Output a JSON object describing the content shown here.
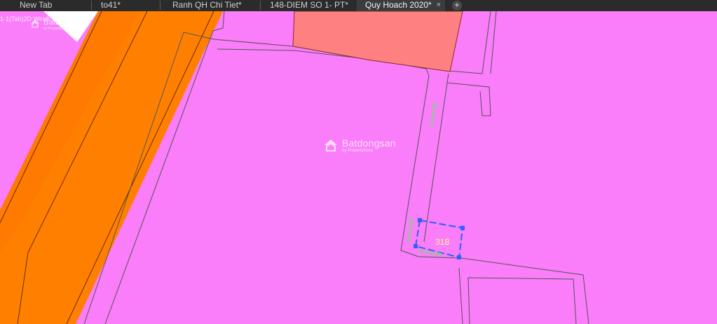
{
  "tabs": [
    {
      "label": "New Tab",
      "active": false
    },
    {
      "label": "to41*",
      "active": false
    },
    {
      "label": "Ranh QH Chi Tiet*",
      "active": false
    },
    {
      "label": "148-DIEM SO 1- PT*",
      "active": false
    },
    {
      "label": "Quy Hoach 2020*",
      "active": true
    }
  ],
  "new_tab_symbol": "+",
  "close_symbol": "×",
  "corner_label": "1-1(Tab)2D Wirefr...",
  "watermark": {
    "name": "Batdongsan",
    "sub": "by PropertyGuru",
    "icon": "batdongsan-logo-icon"
  },
  "map": {
    "parcel_number": "318",
    "road_labels": [
      "Đường đất",
      "Đường đất",
      "Đường đất"
    ]
  },
  "colors": {
    "background": "#fa7dfa",
    "orange_zone": "#ff8000",
    "salmon_block": "#ff8080",
    "parcel_outline": "#3060ff",
    "parcel_number": "#ffff80",
    "road_label": "#40ff40",
    "boundary_lines": "#555555"
  }
}
